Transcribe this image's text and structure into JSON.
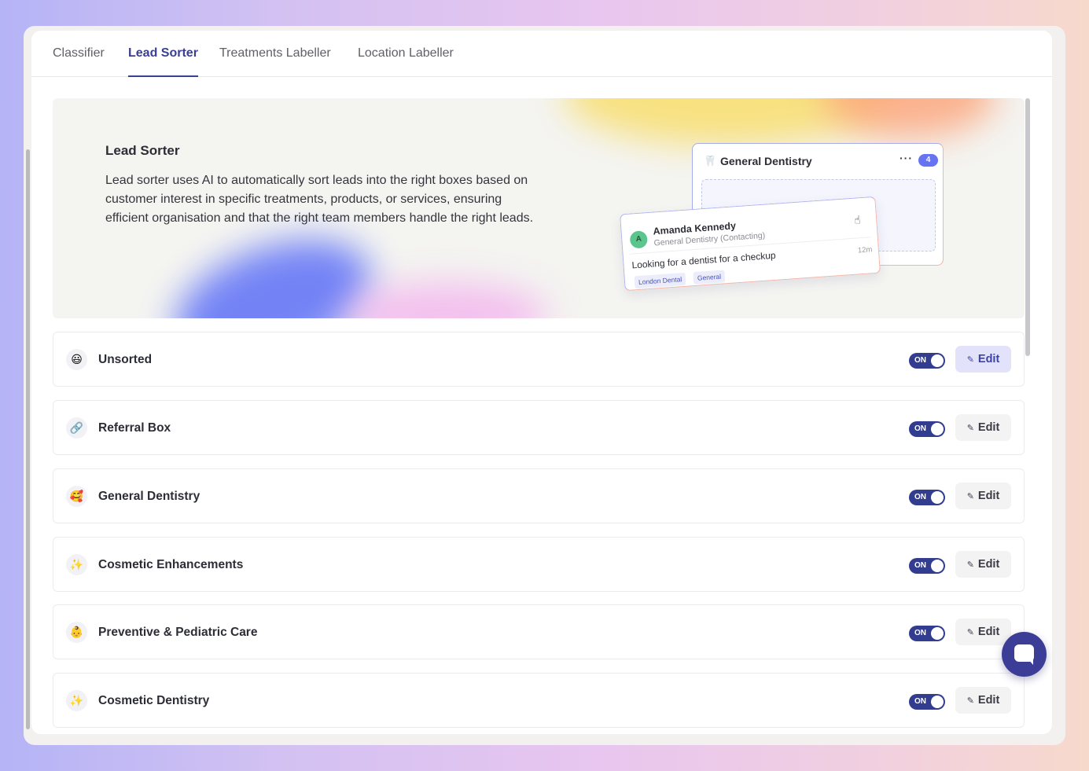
{
  "tabs": [
    {
      "label": "Classifier",
      "active": false
    },
    {
      "label": "Lead Sorter",
      "active": true
    },
    {
      "label": "Treatments Labeller",
      "active": false
    },
    {
      "label": "Location Labeller",
      "active": false
    }
  ],
  "hero": {
    "title": "Lead Sorter",
    "description": "Lead sorter uses AI to automatically sort leads into the right boxes based on customer interest in specific treatments, products, or services, ensuring efficient organisation and that the right team members handle the right leads.",
    "preview": {
      "box_icon": "tooth-icon",
      "box_title": "General Dentistry",
      "box_menu": "···",
      "box_count": "4",
      "lead": {
        "avatar_letter": "A",
        "name": "Amanda Kennedy",
        "subtitle": "General Dentistry (Contacting)",
        "message": "Looking for a dentist for a checkup",
        "time": "12m",
        "tags": [
          "London Dental",
          "General"
        ]
      }
    }
  },
  "boxes": [
    {
      "icon": "😃",
      "icon_name": "grinning-face-icon",
      "label": "Unsorted",
      "toggle": "ON",
      "edit_label": "Edit",
      "highlighted": true
    },
    {
      "icon": "🔗",
      "icon_name": "link-icon",
      "label": "Referral Box",
      "toggle": "ON",
      "edit_label": "Edit",
      "highlighted": false
    },
    {
      "icon": "🥰",
      "icon_name": "smiling-hearts-face-icon",
      "label": "General Dentistry",
      "toggle": "ON",
      "edit_label": "Edit",
      "highlighted": false
    },
    {
      "icon": "✨",
      "icon_name": "sparkles-icon",
      "label": "Cosmetic Enhancements",
      "toggle": "ON",
      "edit_label": "Edit",
      "highlighted": false
    },
    {
      "icon": "👶",
      "icon_name": "baby-icon",
      "label": "Preventive & Pediatric Care",
      "toggle": "ON",
      "edit_label": "Edit",
      "highlighted": false
    },
    {
      "icon": "✨",
      "icon_name": "sparkles-icon",
      "label": "Cosmetic Dentistry",
      "toggle": "ON",
      "edit_label": "Edit",
      "highlighted": false
    }
  ],
  "colors": {
    "accent": "#3b3f93",
    "toggle_on": "#323d8f",
    "chat_button": "#3c3d96"
  }
}
